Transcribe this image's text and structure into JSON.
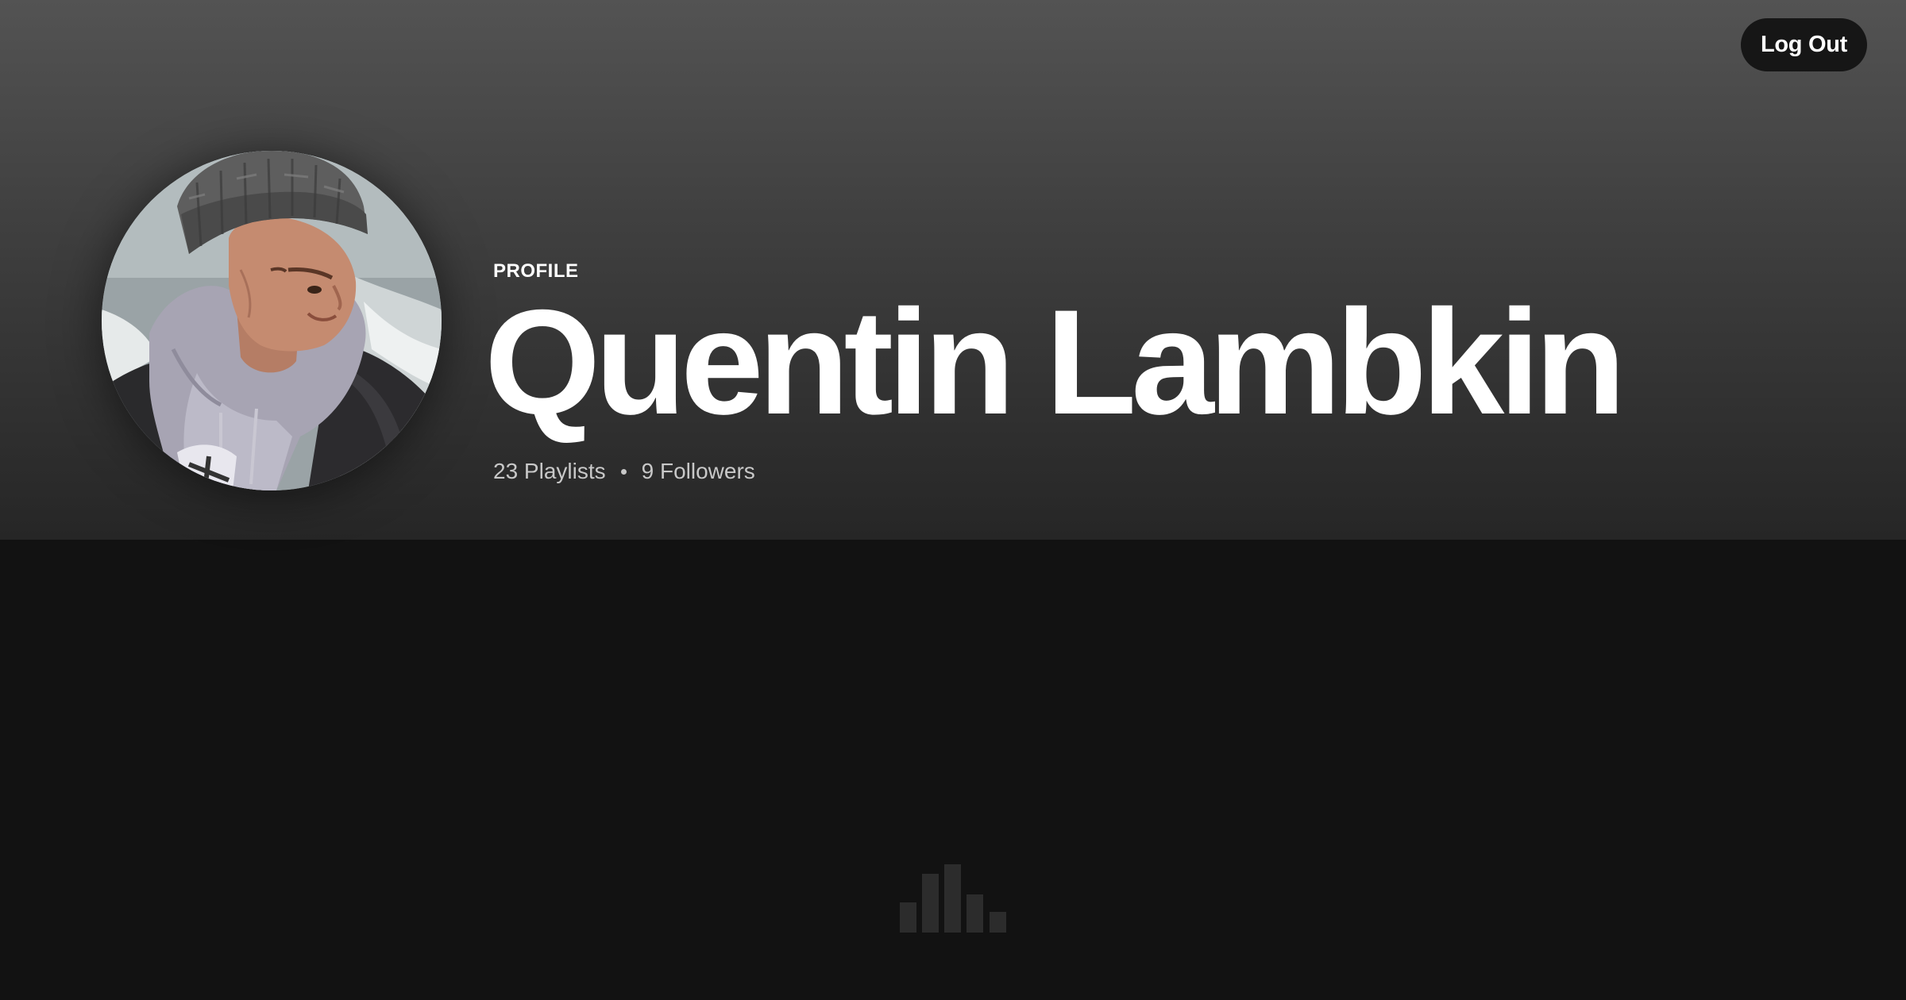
{
  "header": {
    "logout_label": "Log Out"
  },
  "profile": {
    "label": "PROFILE",
    "name": "Quentin Lambkin",
    "playlists": "23 Playlists",
    "followers": "9 Followers"
  },
  "loader": {
    "icon": "loading-bars-icon"
  },
  "colors": {
    "background": "#121212",
    "header_top": "#535353",
    "header_bottom": "#262626",
    "button_bg": "#161616",
    "text_primary": "#ffffff",
    "text_secondary": "#c8c8c8",
    "loader_bar": "#2c2c2c"
  }
}
